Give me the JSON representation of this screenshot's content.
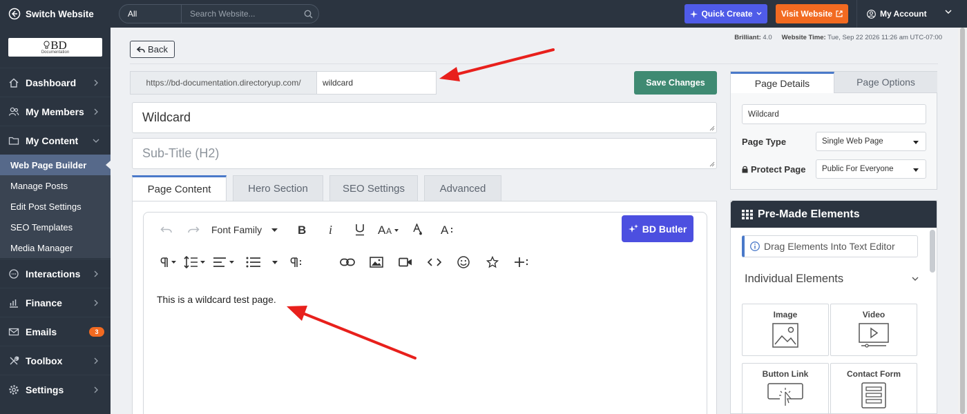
{
  "topbar": {
    "switch_label": "Switch Website",
    "search_scope": "All",
    "search_placeholder": "Search Website...",
    "quick_create": "Quick Create",
    "visit_website": "Visit Website",
    "my_account": "My Account"
  },
  "sidebar": {
    "logo_text": "BD",
    "logo_sub": "Documentation",
    "items": [
      {
        "label": "Dashboard",
        "icon": "home-icon"
      },
      {
        "label": "My Members",
        "icon": "users-icon"
      },
      {
        "label": "My Content",
        "icon": "folder-icon"
      },
      {
        "label": "Interactions",
        "icon": "chat-icon"
      },
      {
        "label": "Finance",
        "icon": "bar-chart-icon"
      },
      {
        "label": "Emails",
        "icon": "mail-icon",
        "badge": "3"
      },
      {
        "label": "Toolbox",
        "icon": "tools-icon"
      },
      {
        "label": "Settings",
        "icon": "gear-icon"
      }
    ],
    "subitems": [
      "Web Page Builder",
      "Manage Posts",
      "Edit Post Settings",
      "SEO Templates",
      "Media Manager"
    ]
  },
  "header": {
    "back_label": "Back",
    "brilliant_label": "Brilliant:",
    "brilliant_value": "4.0",
    "time_label": "Website Time:",
    "time_value": "Tue, Sep 22 2026 11:26 am UTC-07:00"
  },
  "editor_form": {
    "url_prefix": "https://bd-documentation.directoryup.com/",
    "url_value": "wildcard",
    "save_label": "Save Changes",
    "title_value": "Wildcard",
    "subtitle_placeholder": "Sub-Title (H2)",
    "tabs": [
      "Page Content",
      "Hero Section",
      "SEO Settings",
      "Advanced"
    ],
    "font_family_label": "Font Family",
    "butler_label": "BD Butler",
    "body_text": "This is a wildcard test page."
  },
  "page_details": {
    "tabs": [
      "Page Details",
      "Page Options"
    ],
    "name_value": "Wildcard",
    "page_type_label": "Page Type",
    "page_type_value": "Single Web Page",
    "protect_label": "Protect Page",
    "protect_value": "Public For Everyone"
  },
  "premade": {
    "title": "Pre-Made Elements",
    "drag_hint": "Drag Elements Into Text Editor",
    "section": "Individual Elements",
    "elements": [
      "Image",
      "Video",
      "Button Link",
      "Contact Form"
    ]
  },
  "colors": {
    "dark": "#2b3440",
    "accent_blue": "#4a79c9",
    "quick_create": "#4f5be8",
    "visit": "#f26a21",
    "save": "#3f8a72",
    "butler": "#4c4fe0",
    "annotation_arrow": "#e8201c"
  }
}
